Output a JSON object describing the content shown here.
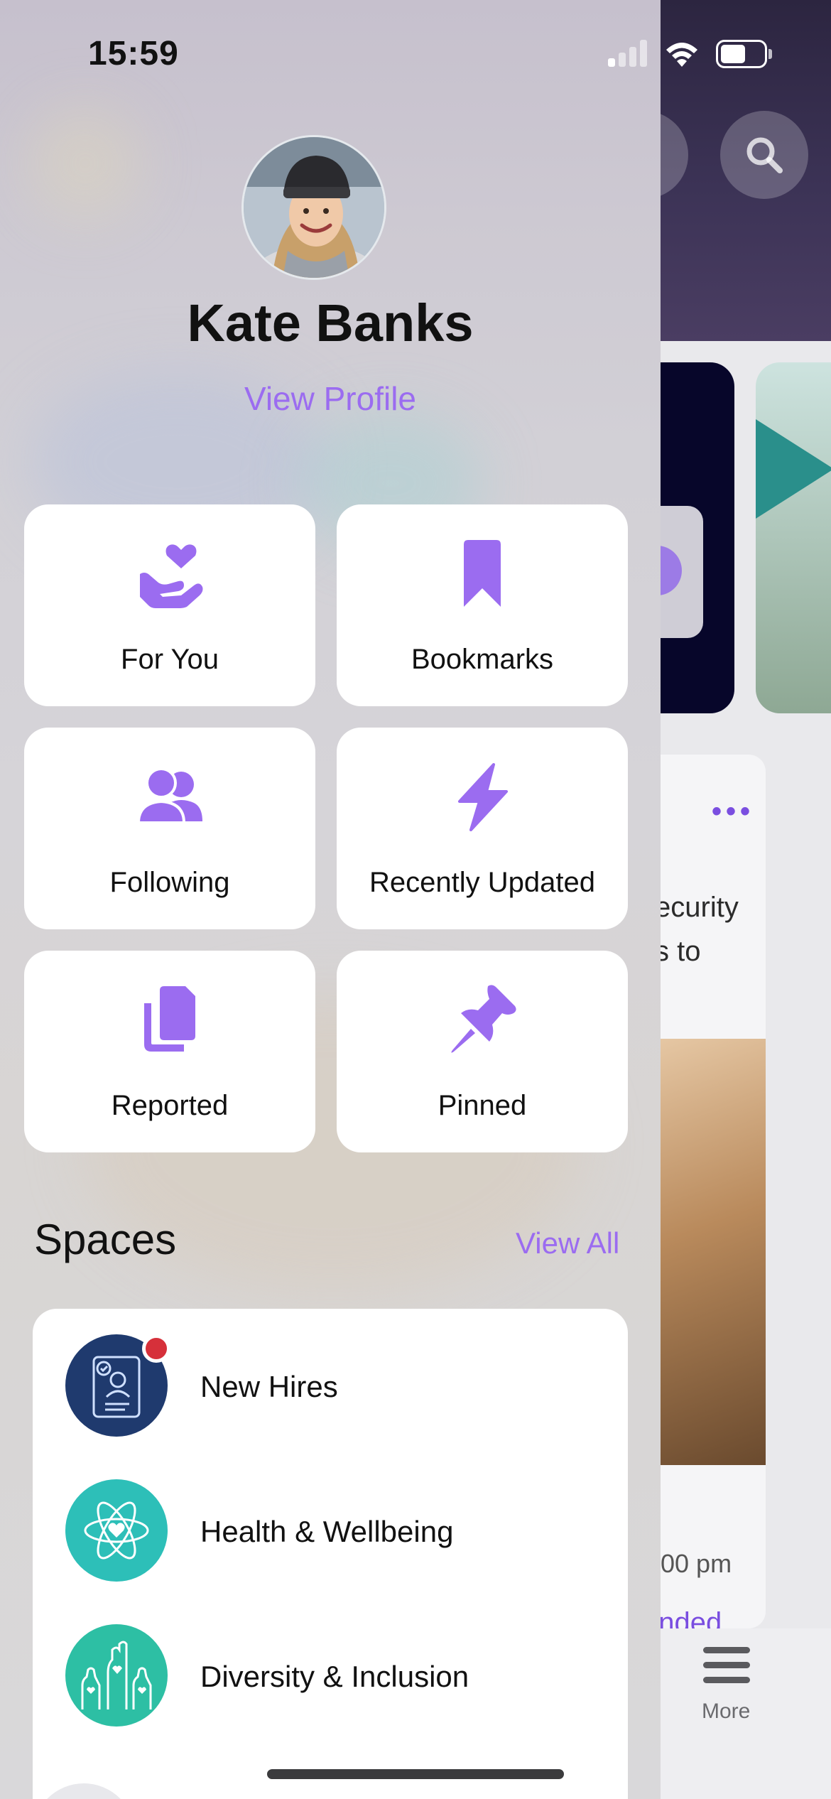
{
  "status_bar": {
    "time": "15:59"
  },
  "profile": {
    "name": "Kate Banks",
    "view_profile_label": "View Profile"
  },
  "menu_tiles": [
    {
      "label": "For You",
      "icon": "heart-hand-icon"
    },
    {
      "label": "Bookmarks",
      "icon": "bookmark-icon"
    },
    {
      "label": "Following",
      "icon": "people-icon"
    },
    {
      "label": "Recently Updated",
      "icon": "bolt-icon"
    },
    {
      "label": "Reported",
      "icon": "documents-icon"
    },
    {
      "label": "Pinned",
      "icon": "pushpin-icon"
    }
  ],
  "spaces": {
    "title": "Spaces",
    "view_all_label": "View All",
    "items": [
      {
        "label": "New Hires",
        "icon": "new-hire-badge-icon",
        "has_notification": true
      },
      {
        "label": "Health & Wellbeing",
        "icon": "atom-heart-icon",
        "has_notification": false
      },
      {
        "label": "Diversity & Inclusion",
        "icon": "raised-hands-icon",
        "has_notification": false
      }
    ]
  },
  "background_app": {
    "post_text_lines": [
      "ecurity",
      "s to",
      "!"
    ],
    "post_time": "00 pm",
    "post_link": "ended",
    "tab_more_label": "More"
  },
  "colors": {
    "accent": "#9B6CF0",
    "new_hires_icon_bg": "#1F3A6E",
    "health_icon_bg": "#2DBFB8",
    "diversity_icon_bg": "#2DBFA4",
    "notification_badge": "#D6303A"
  }
}
